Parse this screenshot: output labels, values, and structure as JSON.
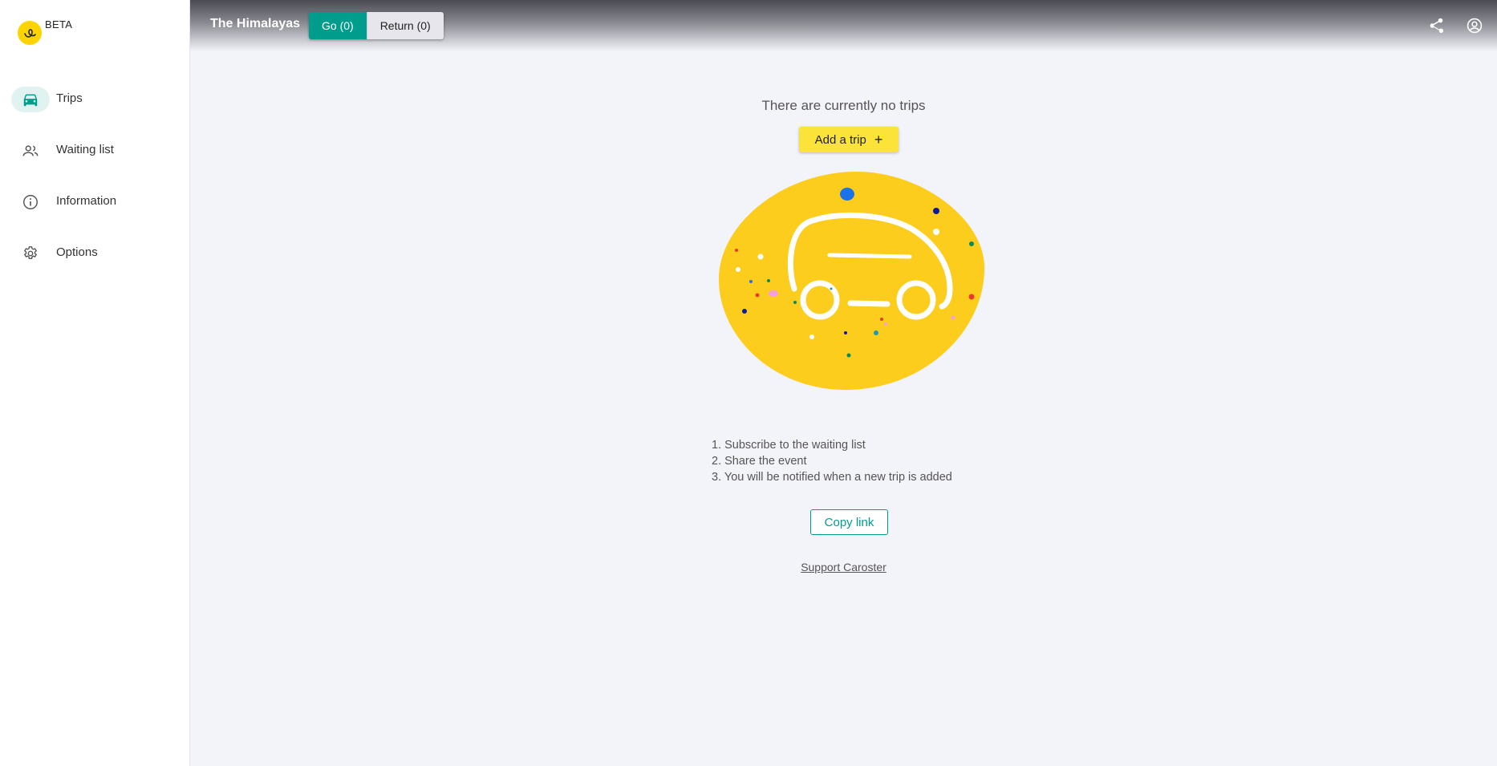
{
  "brand": {
    "badge": "BETA"
  },
  "sidebar": {
    "items": [
      {
        "label": "Trips",
        "icon": "car-icon",
        "active": true
      },
      {
        "label": "Waiting list",
        "icon": "people-icon",
        "active": false
      },
      {
        "label": "Information",
        "icon": "info-icon",
        "active": false
      },
      {
        "label": "Options",
        "icon": "gear-icon",
        "active": false
      }
    ]
  },
  "header": {
    "title": "The Himalayas",
    "go_label": "Go (0)",
    "return_label": "Return (0)",
    "icons": [
      "share-icon",
      "account-icon"
    ]
  },
  "main": {
    "empty_title": "There are currently no trips",
    "add_trip_label": "Add a trip",
    "add_trip_icon": "+",
    "steps": [
      "1. Subscribe to the waiting list",
      "2. Share the event",
      "3. You will be notified when a new trip is added"
    ],
    "copy_link_label": "Copy link",
    "support_label": "Support Caroster"
  },
  "colors": {
    "accent": "#009d8d",
    "brand_yellow": "#fdd400",
    "button_yellow": "#fbe33a",
    "background": "#f3f3fa"
  }
}
